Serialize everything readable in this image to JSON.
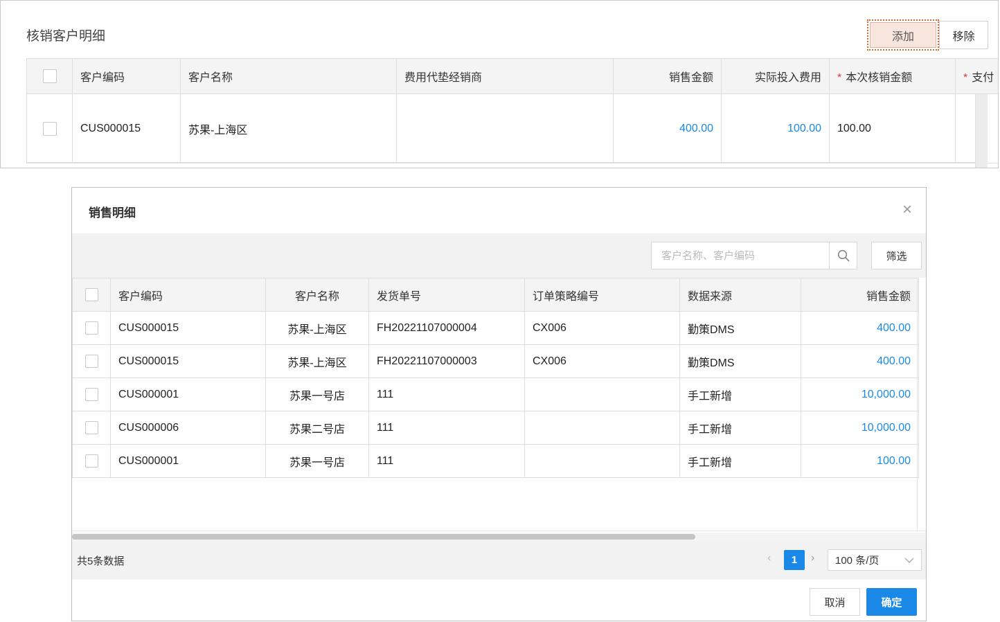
{
  "top_panel": {
    "title": "核销客户明细",
    "add_label": "添加",
    "remove_label": "移除",
    "columns": [
      "客户编码",
      "客户名称",
      "费用代垫经销商",
      "销售金额",
      "实际投入费用",
      "本次核销金额",
      "支付"
    ],
    "required_mark": "*",
    "row": {
      "code": "CUS000015",
      "name": "苏果-上海区",
      "dealer": "",
      "sales_amount": "400.00",
      "actual_cost": "100.00",
      "writeoff_amount": "100.00",
      "pay": ""
    }
  },
  "dialog": {
    "title": "销售明细",
    "close_glyph": "×",
    "search_placeholder": "客户名称、客户编码",
    "filter_label": "筛选",
    "columns": [
      "客户编码",
      "客户名称",
      "发货单号",
      "订单策略编号",
      "数据来源",
      "销售金额"
    ],
    "rows": [
      {
        "code": "CUS000015",
        "name": "苏果-上海区",
        "delivery": "FH20221107000004",
        "strategy": "CX006",
        "source": "勤策DMS",
        "amount": "400.00"
      },
      {
        "code": "CUS000015",
        "name": "苏果-上海区",
        "delivery": "FH20221107000003",
        "strategy": "CX006",
        "source": "勤策DMS",
        "amount": "400.00"
      },
      {
        "code": "CUS000001",
        "name": "苏果一号店",
        "delivery": "111",
        "strategy": "",
        "source": "手工新增",
        "amount": "10,000.00"
      },
      {
        "code": "CUS000006",
        "name": "苏果二号店",
        "delivery": "111",
        "strategy": "",
        "source": "手工新增",
        "amount": "10,000.00"
      },
      {
        "code": "CUS000001",
        "name": "苏果一号店",
        "delivery": "111",
        "strategy": "",
        "source": "手工新增",
        "amount": "100.00"
      }
    ],
    "total_label": "共5条数据",
    "current_page": "1",
    "page_size": "100 条/页",
    "cancel_label": "取消",
    "ok_label": "确定"
  },
  "icons": {
    "search": "search-icon",
    "close": "close-icon",
    "chevron": "chevron-down-icon"
  },
  "colors": {
    "link": "#1a88e6",
    "primary": "#1a88e6",
    "required": "#e53935",
    "highlight": "#d9652b"
  }
}
